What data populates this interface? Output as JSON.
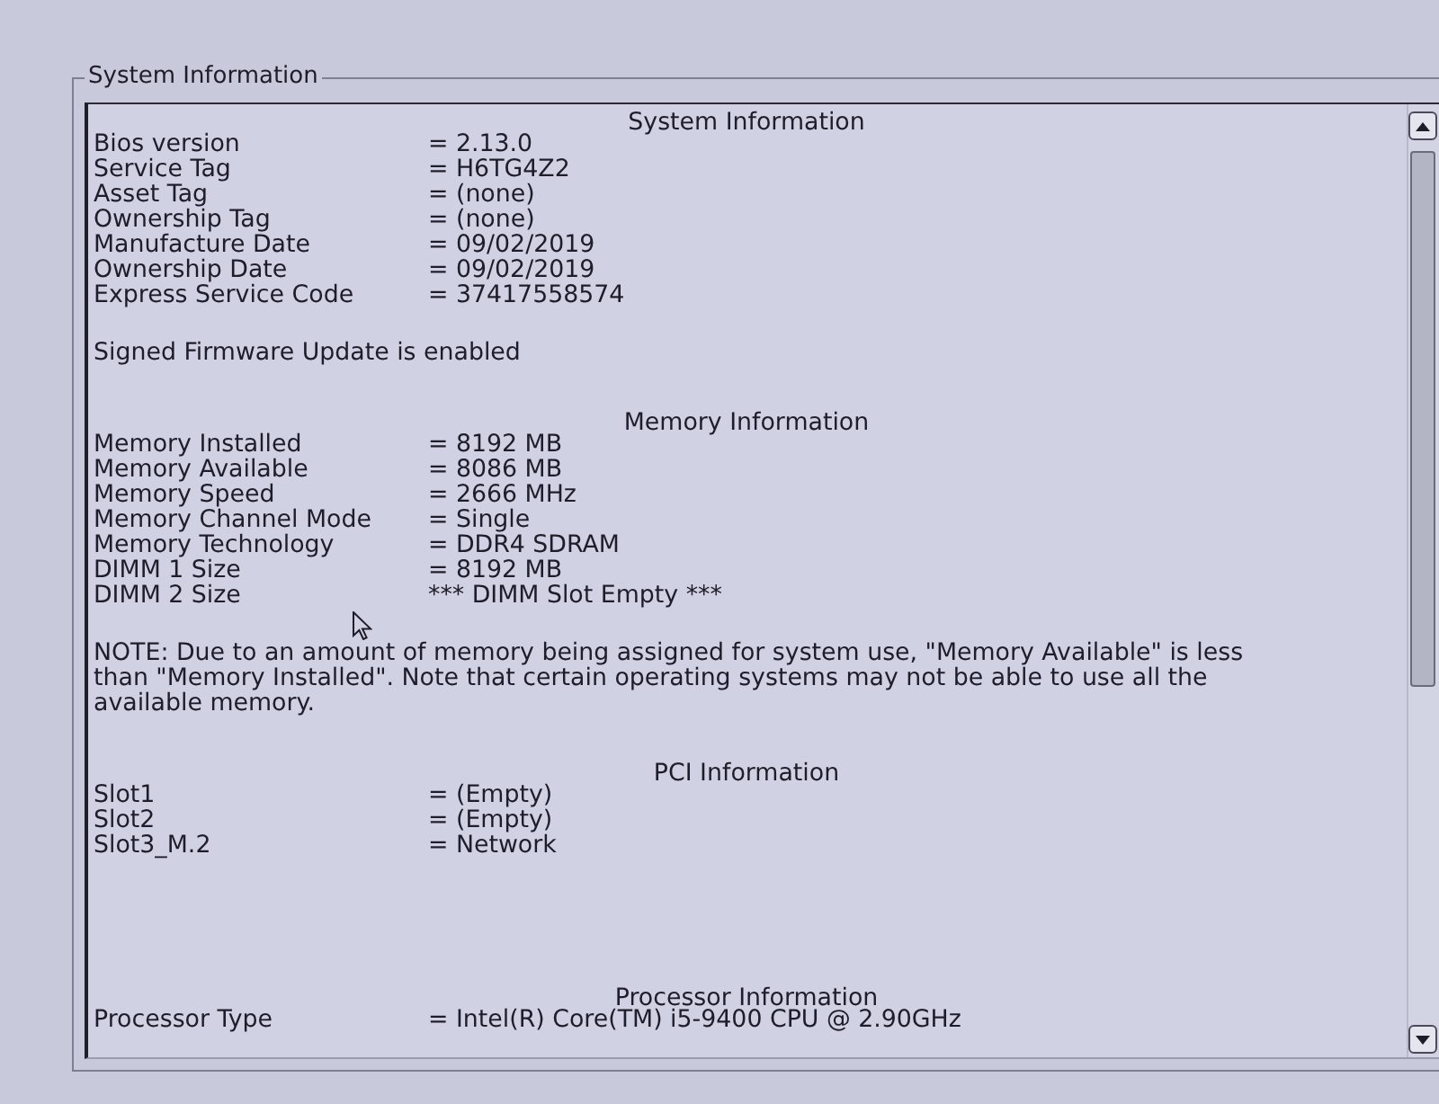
{
  "group_box": {
    "title": "System Information"
  },
  "sections": [
    {
      "heading": "System Information",
      "rows": [
        {
          "label": "Bios version",
          "value": "= 2.13.0"
        },
        {
          "label": "Service Tag",
          "value": "= H6TG4Z2"
        },
        {
          "label": "Asset Tag",
          "value": "= (none)"
        },
        {
          "label": "Ownership Tag",
          "value": "= (none)"
        },
        {
          "label": "Manufacture Date",
          "value": "= 09/02/2019"
        },
        {
          "label": "Ownership Date",
          "value": "= 09/02/2019"
        },
        {
          "label": "Express Service Code",
          "value": "= 37417558574"
        }
      ],
      "notes": [
        "Signed Firmware Update is enabled"
      ]
    },
    {
      "heading": "Memory Information",
      "rows": [
        {
          "label": "Memory Installed",
          "value": "= 8192 MB"
        },
        {
          "label": "Memory Available",
          "value": "= 8086 MB"
        },
        {
          "label": "Memory Speed",
          "value": "= 2666 MHz"
        },
        {
          "label": "Memory Channel Mode",
          "value": "= Single"
        },
        {
          "label": "Memory Technology",
          "value": "= DDR4 SDRAM"
        },
        {
          "label": "DIMM 1 Size",
          "value": "= 8192 MB"
        },
        {
          "label": "DIMM 2 Size",
          "value": "*** DIMM Slot Empty ***"
        }
      ],
      "notes": [
        "NOTE: Due to an amount of memory being assigned for system use, \"Memory Available\" is less than \"Memory Installed\". Note that certain operating systems may not be able to use all the available memory."
      ]
    },
    {
      "heading": "PCI Information",
      "rows": [
        {
          "label": "Slot1",
          "value": "= (Empty)"
        },
        {
          "label": "Slot2",
          "value": "= (Empty)"
        },
        {
          "label": "Slot3_M.2",
          "value": "= Network"
        }
      ]
    },
    {
      "heading": "Processor Information",
      "rows": [
        {
          "label": "Processor Type",
          "value": "= Intel(R) Core(TM) i5-9400 CPU @ 2.90GHz"
        }
      ]
    }
  ]
}
